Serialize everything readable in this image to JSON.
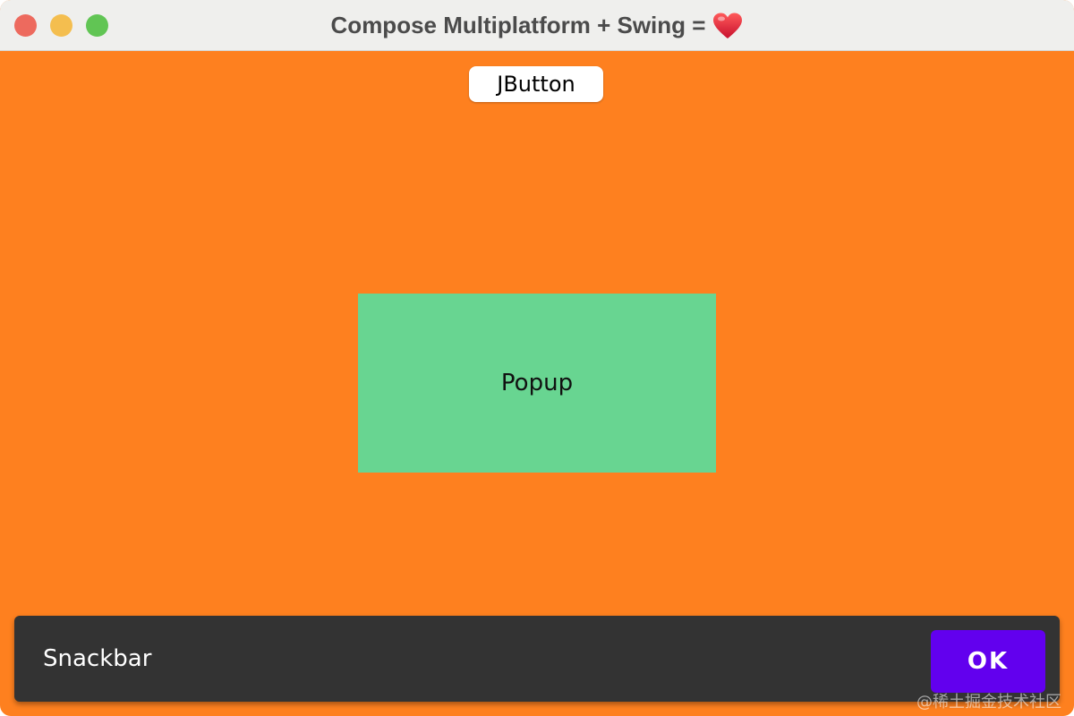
{
  "window": {
    "title": "Compose Multiplatform + Swing =",
    "title_emoji_icon": "heart-icon",
    "traffic_lights": {
      "close_color": "#ed6a5e",
      "minimize_color": "#f4be4f",
      "zoom_color": "#61c554"
    }
  },
  "content": {
    "background_color": "#fe801f",
    "jbutton": {
      "label": "JButton"
    },
    "popup": {
      "label": "Popup",
      "background_color": "#68d591"
    },
    "snackbar": {
      "message": "Snackbar",
      "action_label": "OK",
      "action_color": "#6200ee"
    },
    "watermark": "@稀土掘金技术社区"
  }
}
